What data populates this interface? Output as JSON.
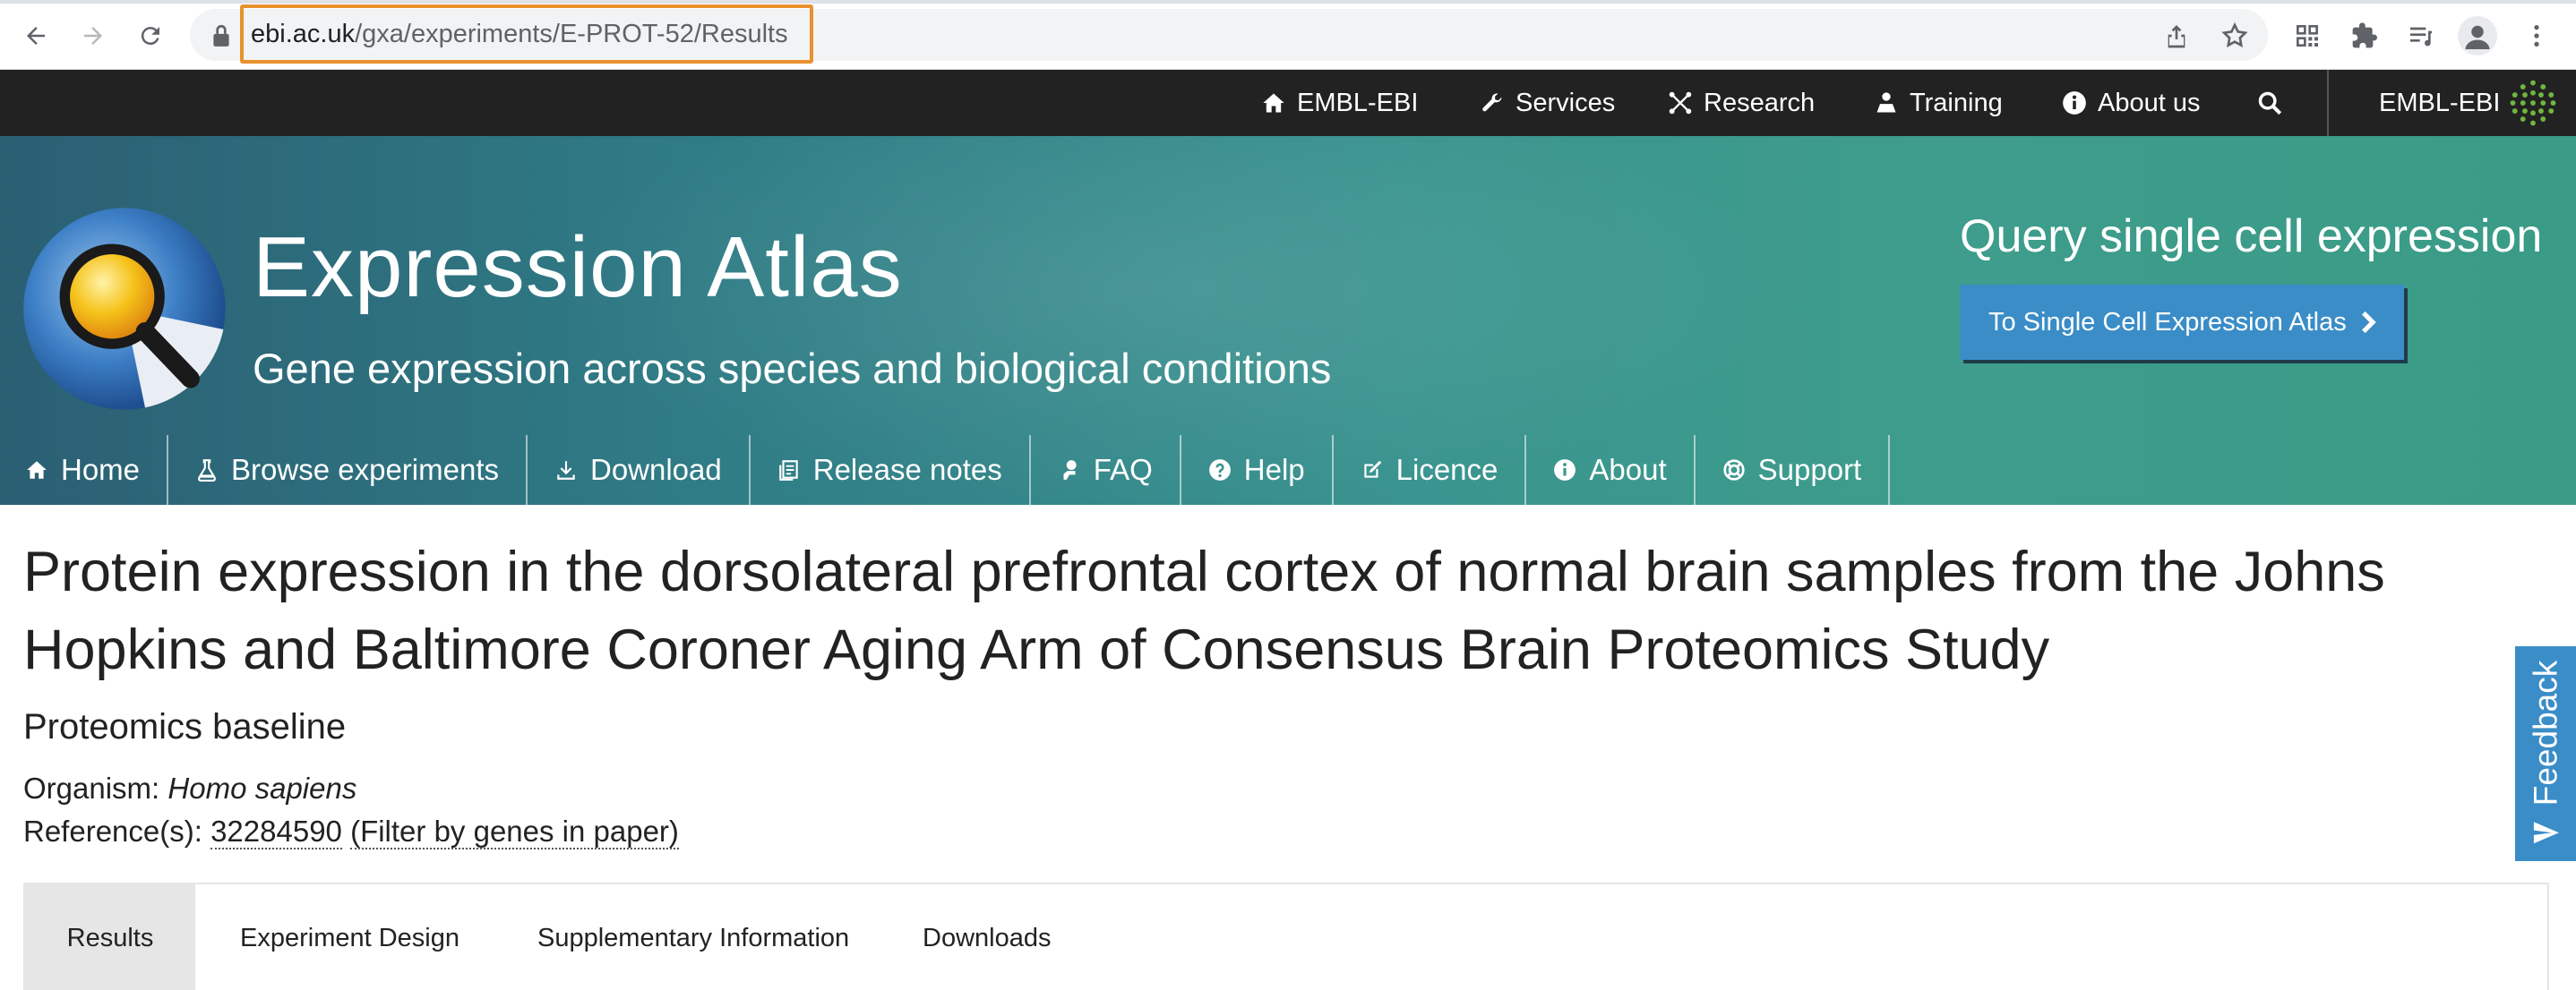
{
  "browser": {
    "url_host": "ebi.ac.uk",
    "url_path": "/gxa/experiments/E-PROT-52/Results"
  },
  "ebi_bar": {
    "items": [
      {
        "label": "EMBL-EBI",
        "icon": "home-icon"
      },
      {
        "label": "Services",
        "icon": "wrench-icon"
      },
      {
        "label": "Research",
        "icon": "research-icon"
      },
      {
        "label": "Training",
        "icon": "training-icon"
      },
      {
        "label": "About us",
        "icon": "info-icon"
      }
    ],
    "brand_label": "EMBL-EBI"
  },
  "masthead": {
    "title": "Expression Atlas",
    "subtitle": "Gene expression across species and biological conditions",
    "single_cell_heading": "Query single cell expression",
    "single_cell_button": "To Single Cell Expression Atlas"
  },
  "main_nav": {
    "items": [
      {
        "label": "Home",
        "icon": "home-icon"
      },
      {
        "label": "Browse experiments",
        "icon": "flask-icon"
      },
      {
        "label": "Download",
        "icon": "download-icon"
      },
      {
        "label": "Release notes",
        "icon": "notes-icon"
      },
      {
        "label": "FAQ",
        "icon": "faq-icon"
      },
      {
        "label": "Help",
        "icon": "help-icon"
      },
      {
        "label": "Licence",
        "icon": "edit-icon"
      },
      {
        "label": "About",
        "icon": "info-icon"
      },
      {
        "label": "Support",
        "icon": "lifebuoy-icon"
      }
    ]
  },
  "experiment": {
    "title": "Protein expression in the dorsolateral prefrontal cortex of normal brain samples from the Johns Hopkins and Baltimore Coroner Aging Arm of Consensus Brain Proteomics Study",
    "type": "Proteomics baseline",
    "organism_label": "Organism:",
    "organism_value": "Homo sapiens",
    "references_label": "Reference(s):",
    "reference_id": "32284590",
    "reference_filter": "(Filter by genes in paper)"
  },
  "tabs": {
    "items": [
      "Results",
      "Experiment Design",
      "Supplementary Information",
      "Downloads"
    ],
    "active": "Results"
  },
  "feedback": {
    "label": "Feedback"
  },
  "colors": {
    "ebi_bar": "#222222",
    "button_blue": "#3a8dc7",
    "url_highlight": "#e8912d",
    "masthead_teal": "#3a948f"
  }
}
